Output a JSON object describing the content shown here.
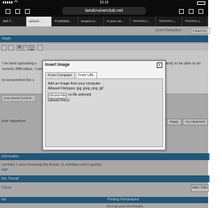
{
  "status": {
    "time": "23:19"
  },
  "browser": {
    "url": "landcruiserclub.net",
    "tabs": [
      "with T...",
      "uploadi...",
      "P1260353...",
      "snopes.co...",
      "Is your car...",
      "TOYOTA L...",
      "TOYOTA L...",
      "TOYOTA L..."
    ]
  },
  "header": {
    "quick_nav": "Quick Navigation",
    "forum_btn": "Forum FA"
  },
  "reply": {
    "title": "Reply"
  },
  "editor": {
    "line1": "I've tried uploading v",
    "line1_right": "andy to be able to do",
    "line2": "onomic difficulties, I can",
    "line3": "to screenshot the s",
    "autosave": "Auto-Saved Content",
    "signature": "your signature"
  },
  "actions": {
    "reply": "Reply",
    "go_advanced": "Go Advanced"
  },
  "pager": "« Previous Thread | Next Thread »",
  "info": {
    "title": "Information",
    "browsing": "currently 1 users browsing this thread. (1 members and 0 guests)",
    "member": "idge"
  },
  "thread": {
    "title": "this Thread",
    "cloud": "Cloud",
    "add_edit": "Add / Edit"
  },
  "footer": {
    "left_title": "rks",
    "perm_title": "Posting Permissions",
    "perm_text": "You may post new threads"
  },
  "modal": {
    "title": "Insert Image",
    "close": "x",
    "tabs": [
      "From Computer",
      "From URL"
    ],
    "add_text": "Add an Image from your computer",
    "allowed": "Allowed Filetypes: jpg, jpeg, png, gif",
    "choose": "Choose File",
    "no_file": "no file selected",
    "upload": "Upload File(s)"
  }
}
